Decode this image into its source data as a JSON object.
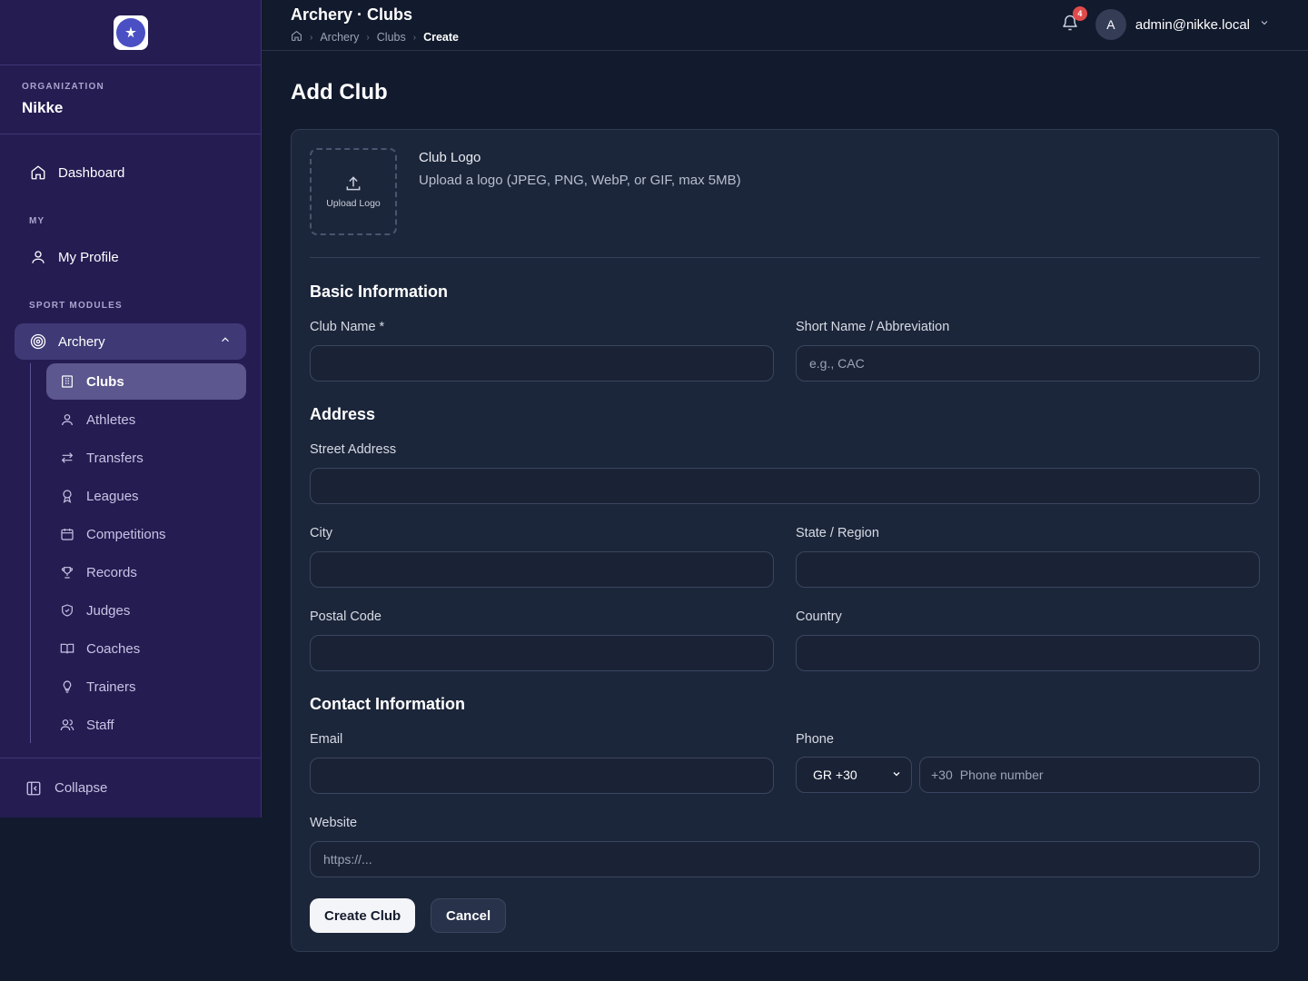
{
  "header": {
    "title": "Archery · Clubs",
    "breadcrumbs": [
      "Archery",
      "Clubs",
      "Create"
    ],
    "notification_count": "4",
    "user_initial": "A",
    "user_email": "admin@nikke.local"
  },
  "sidebar": {
    "org_label": "ORGANIZATION",
    "org_name": "Nikke",
    "dashboard": "Dashboard",
    "my_label": "MY",
    "my_profile": "My Profile",
    "sport_label": "SPORT MODULES",
    "archery": "Archery",
    "sub_items": [
      "Clubs",
      "Athletes",
      "Transfers",
      "Leagues",
      "Competitions",
      "Records",
      "Judges",
      "Coaches",
      "Trainers",
      "Staff"
    ],
    "collapse": "Collapse"
  },
  "page": {
    "title": "Add Club",
    "logo_title": "Club Logo",
    "logo_help": "Upload a logo (JPEG, PNG, WebP, or GIF, max 5MB)",
    "upload_label": "Upload Logo",
    "basic_title": "Basic Information",
    "club_name_label": "Club Name *",
    "club_name_value": "",
    "short_name_label": "Short Name / Abbreviation",
    "short_name_placeholder": "e.g., CAC",
    "address_title": "Address",
    "street_label": "Street Address",
    "city_label": "City",
    "state_label": "State / Region",
    "postal_label": "Postal Code",
    "country_label": "Country",
    "contact_title": "Contact Information",
    "email_label": "Email",
    "phone_label": "Phone",
    "phone_country": "GR +30",
    "phone_prefix": "+30",
    "phone_placeholder": "Phone number",
    "website_label": "Website",
    "website_placeholder": "https://...",
    "create_button": "Create Club",
    "cancel_button": "Cancel"
  }
}
